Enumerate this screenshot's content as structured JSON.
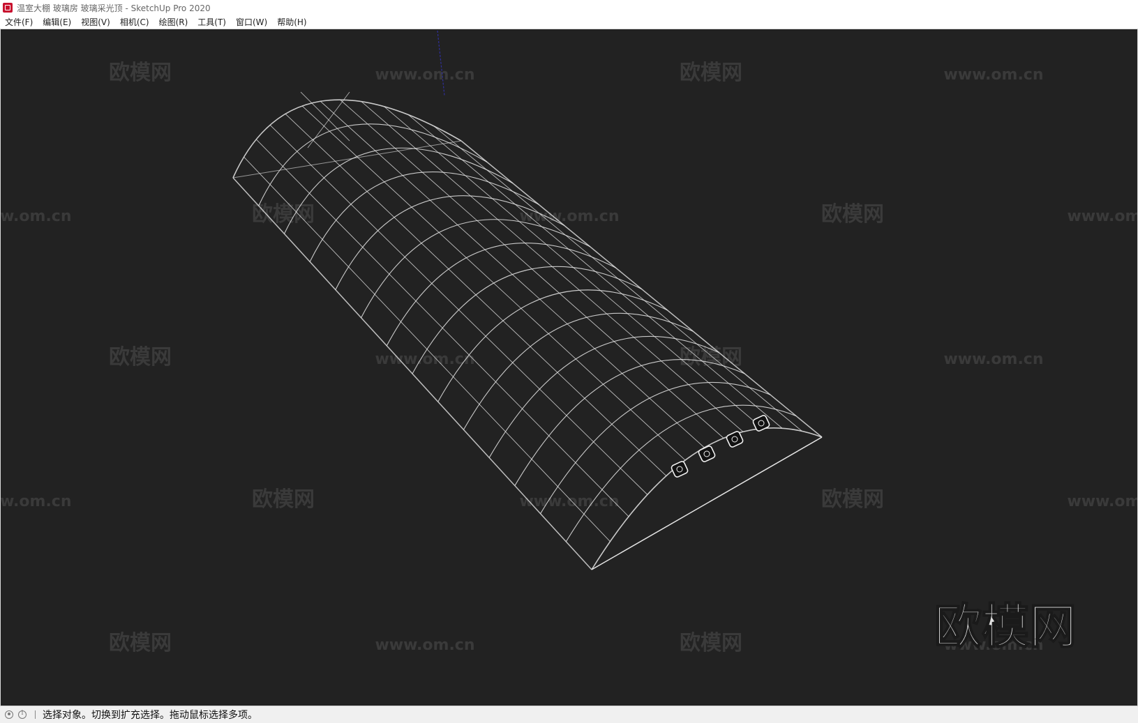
{
  "window": {
    "title": "温室大棚 玻璃房 玻璃采光顶 - SketchUp Pro 2020",
    "app_icon": "sketchup-icon"
  },
  "menu": {
    "items": [
      "文件(F)",
      "编辑(E)",
      "视图(V)",
      "相机(C)",
      "绘图(R)",
      "工具(T)",
      "窗口(W)",
      "帮助(H)"
    ]
  },
  "viewport": {
    "background": "#222222",
    "model_edge_color": "#e6e6e6",
    "axis_color": "#2f2f9a",
    "watermark_text": "欧模网",
    "watermark_url": "www.om.cn",
    "logo_text": "欧模网"
  },
  "status": {
    "icons": [
      "geo-location-icon",
      "info-icon"
    ],
    "text": "选择对象。切换到扩充选择。拖动鼠标选择多项。"
  }
}
